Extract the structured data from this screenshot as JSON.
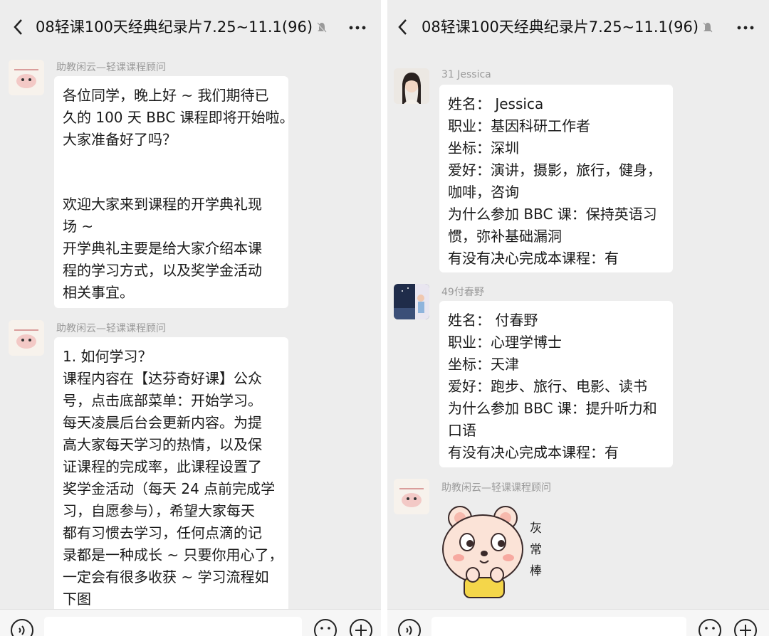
{
  "left": {
    "title": "08轻课100天经典纪录片7.25~11.1(96)",
    "messages": [
      {
        "sender": "助教闲云—轻课课程顾问",
        "lines": [
          "各位同学，晚上好 ~ 我们期待已",
          "久的 100 天 BBC 课程即将开始啦。",
          "大家准备好了吗？"
        ],
        "lines2": [
          "欢迎大家来到课程的开学典礼现",
          "场 ~",
          "开学典礼主要是给大家介绍本课",
          "程的学习方式，以及奖学金活动",
          "相关事宜。"
        ]
      },
      {
        "sender": "助教闲云—轻课课程顾问",
        "lines": [
          "1. 如何学习？",
          "课程内容在【达芬奇好课】公众",
          "号，点击底部菜单：开始学习。",
          "每天凌晨后台会更新内容。为提",
          "高大家每天学习的热情，以及保",
          "证课程的完成率，此课程设置了",
          "奖学金活动（每天 24 点前完成学",
          "习，自愿参与），希望大家每天",
          "都有习惯去学习，任何点滴的记",
          "录都是一种成长 ~ 只要你用心了，",
          "一定会有很多收获 ~ 学习流程如",
          "下图"
        ]
      }
    ]
  },
  "right": {
    "title": "08轻课100天经典纪录片7.25~11.1(96)",
    "messages": [
      {
        "sender": "31 Jessica",
        "lines": [
          "姓名： Jessica",
          "职业：基因科研工作者",
          "坐标：深圳",
          "爱好：演讲，摄影，旅行，健身，",
          "咖啡，咨询",
          "为什么参加 BBC 课：保持英语习",
          "惯，弥补基础漏洞",
          "有没有决心完成本课程：有"
        ]
      },
      {
        "sender": "49付春野",
        "lines": [
          "姓名： 付春野",
          "职业：心理学博士",
          "坐标：天津",
          "爱好：跑步、旅行、电影、读书",
          "为什么参加 BBC 课：提升听力和",
          "口语",
          "有没有决心完成本课程：有"
        ]
      },
      {
        "sender": "助教闲云—轻课课程顾问",
        "sticker_text": [
          "灰",
          "常",
          "棒"
        ]
      }
    ]
  },
  "colors": {
    "background": "#ededed",
    "bubble": "#ffffff",
    "sender": "#9a9a9a",
    "sticker_face": "#fbe3d7"
  },
  "icons": [
    "back-chevron-icon",
    "mute-bell-icon",
    "more-dots-icon",
    "voice-icon",
    "emoji-icon",
    "plus-icon"
  ]
}
